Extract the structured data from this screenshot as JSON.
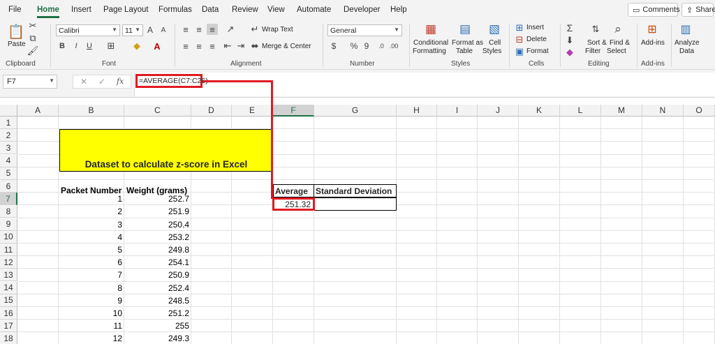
{
  "menu": {
    "tabs": [
      "File",
      "Home",
      "Insert",
      "Page Layout",
      "Formulas",
      "Data",
      "Review",
      "View",
      "Automate",
      "Developer",
      "Help"
    ],
    "active": "Home",
    "comments_label": "Comments",
    "share_label": "Share"
  },
  "ribbon": {
    "clipboard": {
      "paste": "Paste",
      "label": "Clipboard"
    },
    "font": {
      "name": "Calibri",
      "size": "11",
      "bold": "B",
      "italic": "I",
      "underline": "U",
      "label": "Font"
    },
    "alignment": {
      "wrap": "Wrap Text",
      "merge": "Merge & Center",
      "label": "Alignment"
    },
    "number": {
      "format": "General",
      "currency": "$",
      "percent": "%",
      "comma": "9",
      "label": "Number"
    },
    "styles": {
      "conditional": "Conditional",
      "conditional2": "Formatting",
      "format_table": "Format as",
      "format_table2": "Table",
      "cell_styles": "Cell",
      "cell_styles2": "Styles",
      "label": "Styles"
    },
    "cells": {
      "insert": "Insert",
      "delete": "Delete",
      "format": "Format",
      "label": "Cells"
    },
    "editing": {
      "sort": "Sort &",
      "sort2": "Filter",
      "find": "Find &",
      "find2": "Select",
      "label": "Editing"
    },
    "addins": {
      "addins": "Add-ins",
      "label": "Add-ins"
    },
    "analyze": {
      "line1": "Analyze",
      "line2": "Data"
    }
  },
  "formula_bar": {
    "name_box": "F7",
    "fx": "fx",
    "formula": "=AVERAGE(C7:C26)"
  },
  "grid": {
    "columns": [
      "A",
      "B",
      "C",
      "D",
      "E",
      "F",
      "G",
      "H",
      "I",
      "J",
      "K",
      "L",
      "M",
      "N",
      "O"
    ],
    "rows": [
      "1",
      "2",
      "3",
      "4",
      "5",
      "6",
      "7",
      "8",
      "9",
      "10",
      "11",
      "12",
      "13",
      "14",
      "15",
      "16",
      "17",
      "18"
    ],
    "selected_column": "F",
    "selected_row": "7",
    "title": "Dataset to calculate z-score in Excel",
    "header_packet": "Packet Number",
    "header_weight": "Weight (grams)",
    "header_average": "Average",
    "header_std": "Standard Deviation",
    "average_value": "251.32",
    "std_value": "",
    "data": [
      {
        "packet": "1",
        "weight": "252.7"
      },
      {
        "packet": "2",
        "weight": "251.9"
      },
      {
        "packet": "3",
        "weight": "250.4"
      },
      {
        "packet": "4",
        "weight": "253.2"
      },
      {
        "packet": "5",
        "weight": "249.8"
      },
      {
        "packet": "6",
        "weight": "254.1"
      },
      {
        "packet": "7",
        "weight": "250.9"
      },
      {
        "packet": "8",
        "weight": "252.4"
      },
      {
        "packet": "9",
        "weight": "248.5"
      },
      {
        "packet": "10",
        "weight": "251.2"
      },
      {
        "packet": "11",
        "weight": "255"
      },
      {
        "packet": "12",
        "weight": "249.3"
      }
    ]
  },
  "colors": {
    "accent": "#1e7145",
    "highlight": "#ffff00",
    "annotation": "#e01a22"
  }
}
